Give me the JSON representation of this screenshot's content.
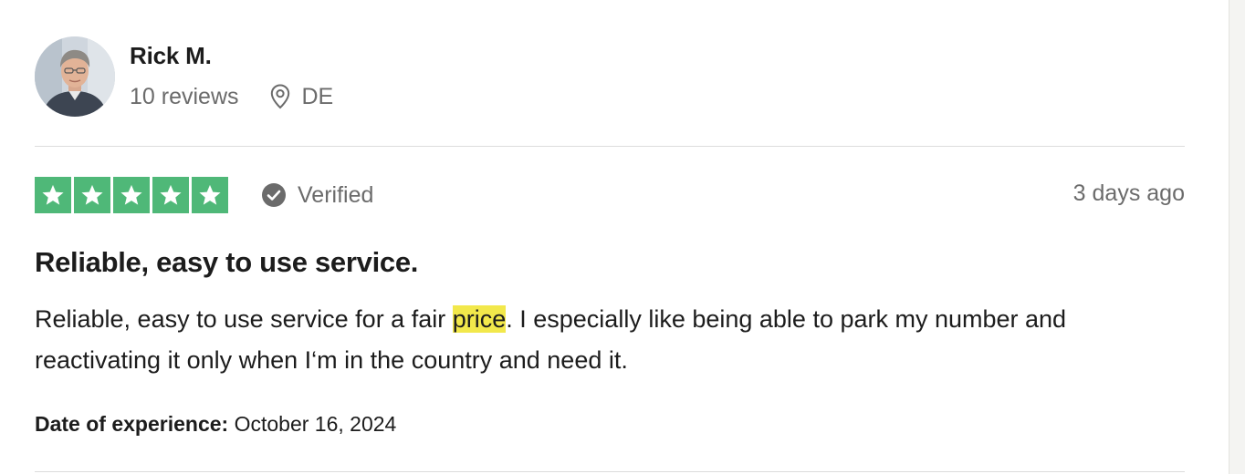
{
  "reviewer": {
    "name": "Rick M.",
    "review_count": "10 reviews",
    "location": "DE",
    "avatar_icon": "person-photo"
  },
  "review": {
    "rating": 5,
    "rating_max": 5,
    "star_color": "#4fb878",
    "verified_label": "Verified",
    "time_ago": "3 days ago",
    "title": "Reliable, easy to use service.",
    "body_before": "Reliable, easy to use service for a fair ",
    "body_highlight": "price",
    "body_after": ". I especially like being able to park my number and reactivating it only when I‘m in the country and need it.",
    "highlight_color": "#f2e84b",
    "experience_label": "Date of experience:",
    "experience_date": " October 16, 2024"
  },
  "icons": {
    "location": "map-pin-icon",
    "verified": "check-circle-icon",
    "star": "star-icon"
  }
}
